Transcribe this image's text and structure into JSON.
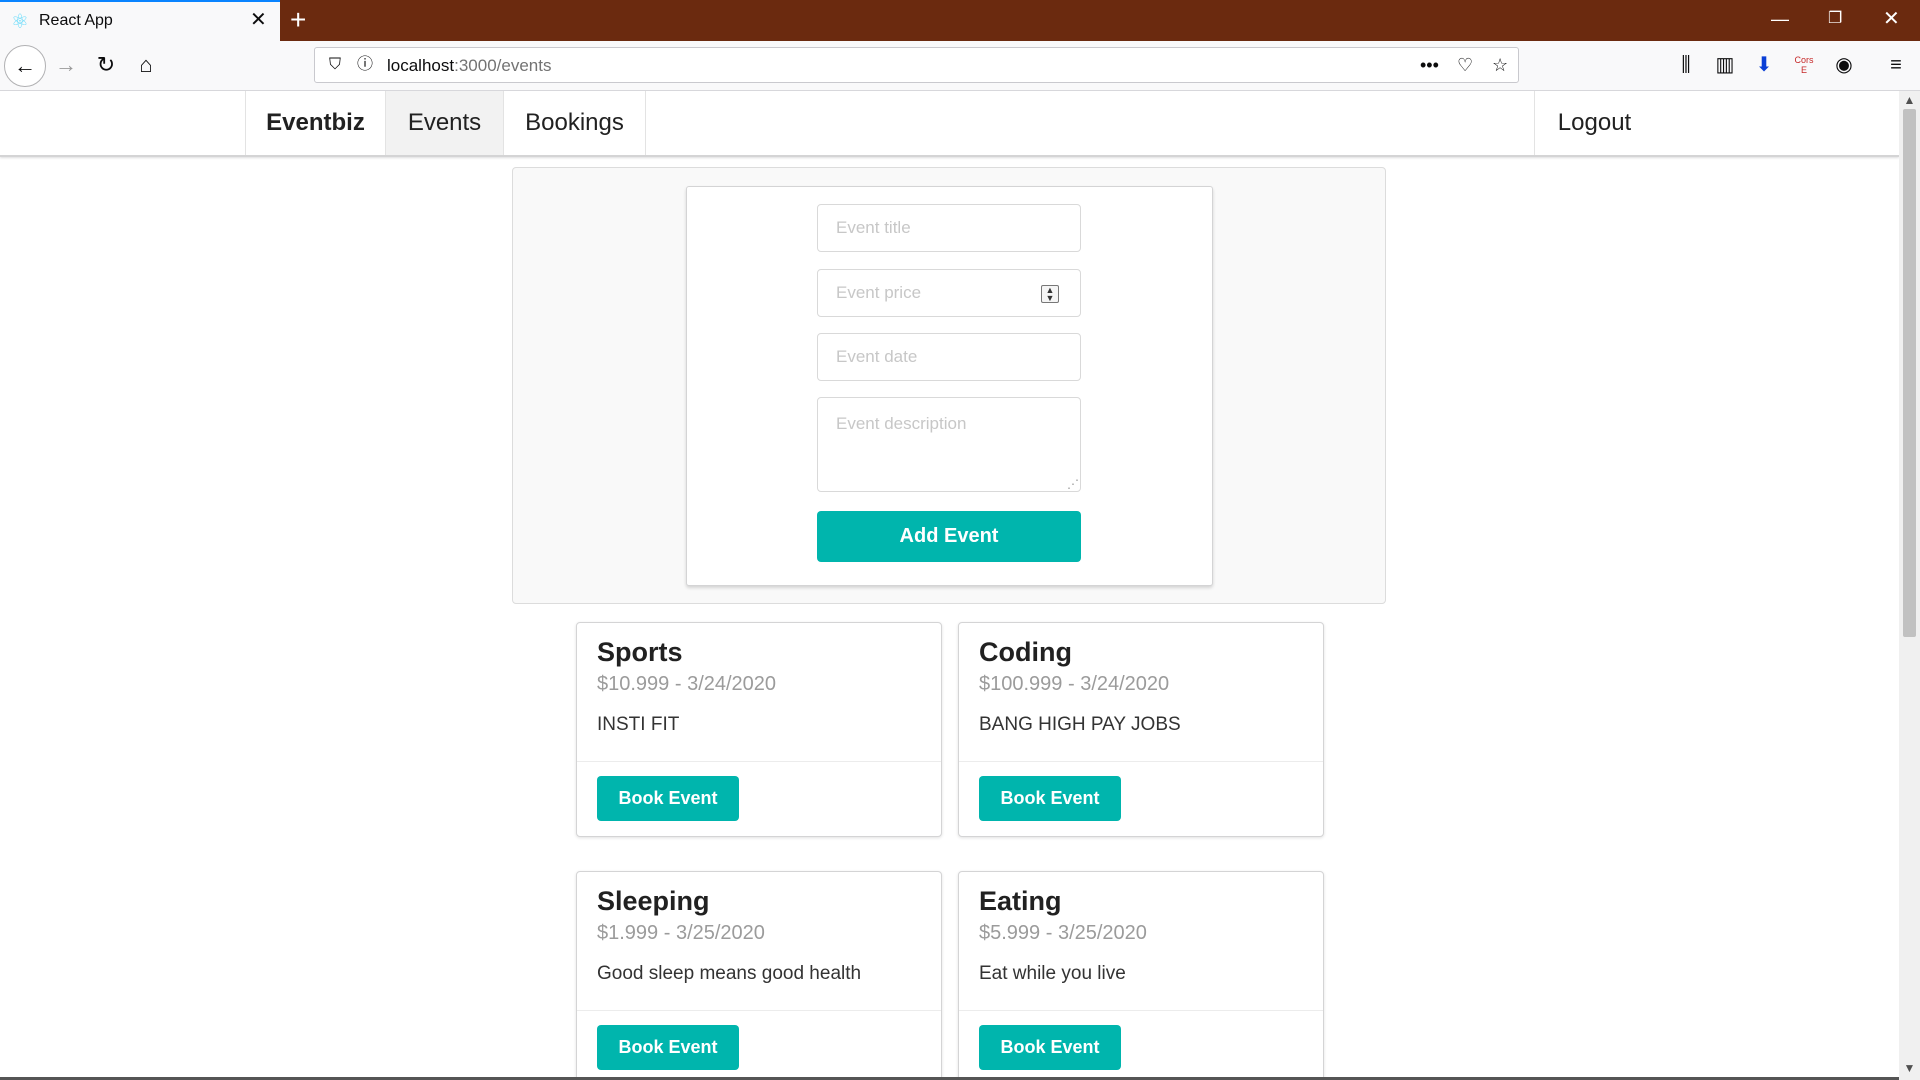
{
  "browser": {
    "tab_title": "React App",
    "url_host": "localhost",
    "url_path": ":3000/events",
    "toolbar_icons": [
      "library-icon",
      "sidebar-icon",
      "download-icon",
      "cors-extension-icon",
      "account-icon",
      "menu-icon"
    ],
    "cors_label": "Cors E"
  },
  "nav": {
    "brand": "Eventbiz",
    "items": [
      "Events",
      "Bookings"
    ],
    "active": "Events",
    "logout": "Logout"
  },
  "form": {
    "title_placeholder": "Event title",
    "price_placeholder": "Event price",
    "date_placeholder": "Event date",
    "description_placeholder": "Event description",
    "submit_label": "Add Event"
  },
  "events": [
    {
      "title": "Sports",
      "meta": "$10.999 - 3/24/2020",
      "description": "INSTI FIT",
      "button": "Book Event"
    },
    {
      "title": "Coding",
      "meta": "$100.999 - 3/24/2020",
      "description": "BANG HIGH PAY JOBS",
      "button": "Book Event"
    },
    {
      "title": "Sleeping",
      "meta": "$1.999 - 3/25/2020",
      "description": "Good sleep means good health",
      "button": "Book Event"
    },
    {
      "title": "Eating",
      "meta": "$5.999 - 3/25/2020",
      "description": "Eat while you live",
      "button": "Book Event"
    }
  ],
  "colors": {
    "accent": "#00b5ad",
    "titlebar": "#6b2a0f"
  }
}
